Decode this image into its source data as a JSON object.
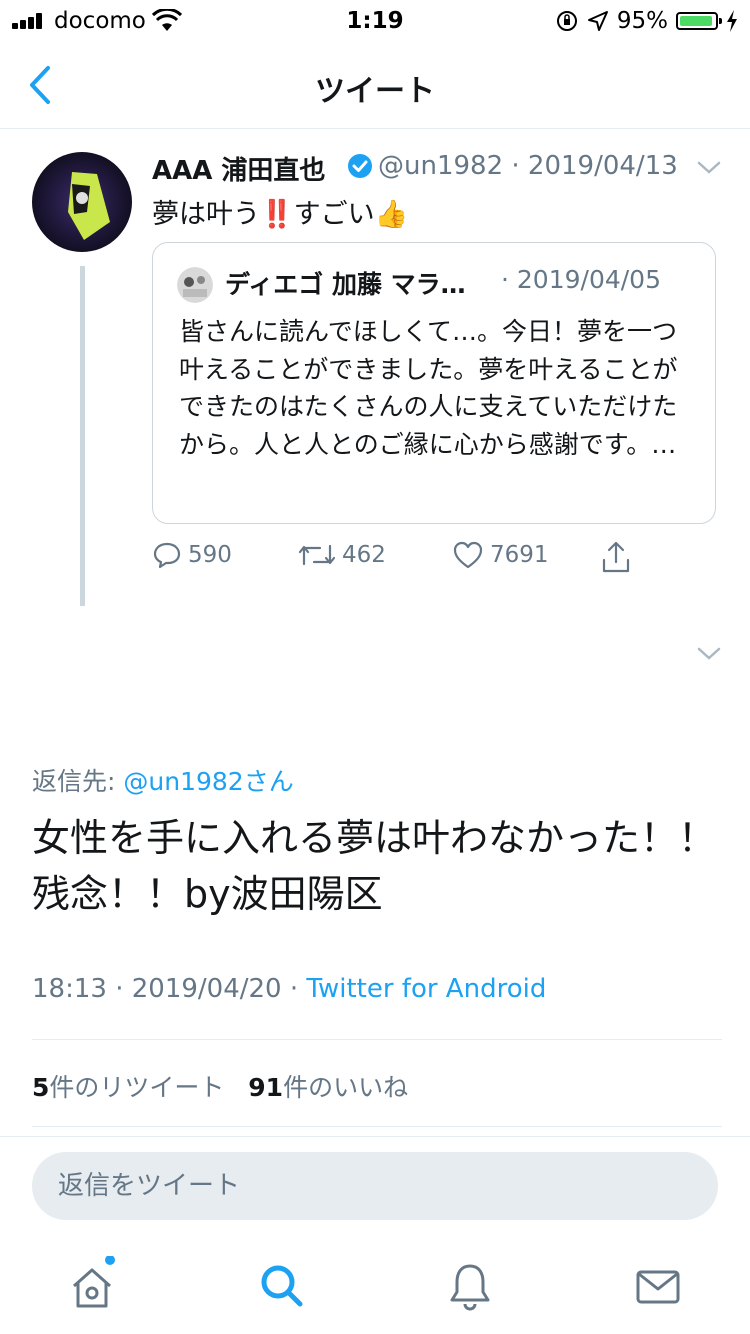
{
  "status_bar": {
    "carrier": "docomo",
    "time": "1:19",
    "battery": "95%",
    "battery_level": 0.95
  },
  "nav": {
    "title": "ツイート",
    "back_icon": "chevron-left-icon"
  },
  "quoted_parent": {
    "author_name": "AAA 浦田直也",
    "handle": "@un1982",
    "date": "2019/04/13",
    "text": "夢は叶う‼️すごい👍",
    "quote": {
      "author_name": "ディエゴ 加藤 マラ…",
      "date": "2019/04/05",
      "text": "皆さんに読んでほしくて…。今日！夢を一つ叶えることができました。夢を叶えることができたのはたくさんの人に支えていただけたから。人と人とのご縁に心から感謝です。…"
    },
    "actions": {
      "replies": "590",
      "retweets": "462",
      "likes": "7691"
    }
  },
  "main_tweet": {
    "reply_label": "返信先: ",
    "reply_handle": "@un1982さん",
    "text": "女性を手に入れる夢は叶わなかった！！残念！！by波田陽区",
    "time": "18:13",
    "date": "2019/04/20",
    "source": "Twitter for Android",
    "retweet_count": "5",
    "retweet_label": "件のリツイート",
    "like_count": "91",
    "like_label": "件のいいね"
  },
  "compose": {
    "placeholder": "返信をツイート"
  },
  "tabbar": {
    "items": [
      "home-icon",
      "search-icon",
      "notifications-icon",
      "messages-icon"
    ]
  },
  "colors": {
    "accent": "#1da1f2",
    "secondary_text": "#657786",
    "divider": "#e6ecf0",
    "battery_fill": "#4cd964"
  }
}
